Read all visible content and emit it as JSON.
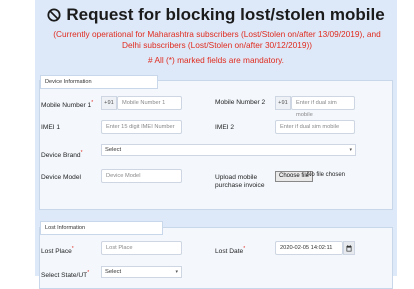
{
  "header": {
    "title": "Request for blocking lost/stolen mobile",
    "notice": "(Currently operational for Maharashtra subscribers (Lost/Stolen on/after 13/09/2019), and Delhi subscribers (Lost/Stolen on/after 30/12/2019))",
    "mandatory_note": "# All (*) marked fields are mandatory."
  },
  "device_info": {
    "section_title": "Device Information",
    "mobile1": {
      "label": "Mobile Number 1",
      "prefix": "+91",
      "placeholder": "Mobile Number 1"
    },
    "mobile2": {
      "label": "Mobile Number 2",
      "prefix": "+91",
      "placeholder": "Enter if dual sim mobile"
    },
    "imei1": {
      "label": "IMEI 1",
      "placeholder": "Enter 15 digit IMEI Number"
    },
    "imei2": {
      "label": "IMEI 2",
      "placeholder": "Enter if dual sim mobile"
    },
    "brand": {
      "label": "Device Brand",
      "selected": "Select"
    },
    "model": {
      "label": "Device Model",
      "placeholder": "Device Model"
    },
    "invoice": {
      "label_line1": "Upload mobile",
      "label_line2": "purchase invoice",
      "button": "Choose file",
      "status": "No file chosen"
    }
  },
  "lost_info": {
    "section_title": "Lost Information",
    "place": {
      "label": "Lost Place",
      "placeholder": "Lost Place"
    },
    "date": {
      "label": "Lost Date",
      "value": "2020-02-05 14:02:11"
    },
    "state": {
      "label": "Select State/UT",
      "selected": "Select"
    }
  },
  "icons": {
    "title": "no-entry-icon",
    "calendar": "calendar-icon"
  },
  "colors": {
    "panel": "#dde9f8",
    "notice": "#e02b1f"
  }
}
